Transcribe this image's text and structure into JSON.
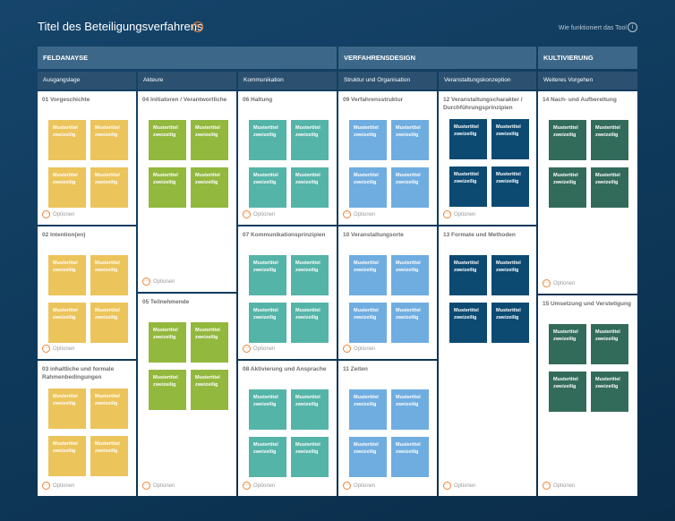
{
  "header": {
    "title": "Titel des Beteiligungsverfahrens",
    "help_link": "Wie funktioniert das Tool",
    "edit_icon": "pencil-icon",
    "info_icon": "info-icon"
  },
  "colors": {
    "yellow": "#ecc45c",
    "green": "#93b83e",
    "teal": "#55b4a8",
    "blue": "#6fade0",
    "navy": "#0c4a72",
    "darkgreen": "#336b5a",
    "accent": "#e8853b"
  },
  "sections": [
    {
      "label": "FELDANAYSE"
    },
    {
      "label": "VERFAHRENSDESIGN"
    },
    {
      "label": "KULTIVIERUNG"
    }
  ],
  "columns": [
    {
      "label": "Ausgangslage"
    },
    {
      "label": "Akteure"
    },
    {
      "label": "Kommunikation"
    },
    {
      "label": "Struktur und Organisation"
    },
    {
      "label": "Veranstaltungskonzeption"
    },
    {
      "label": "Weiteres Vorgehen"
    }
  ],
  "note": {
    "line1": "Mustertitel",
    "line2": "zweizeilig"
  },
  "options_label": "Optionen",
  "panels": [
    {
      "title": "01 Vorgeschichte"
    },
    {
      "title": "02 Intention(en)"
    },
    {
      "title": "03 inhaltliche und formale Rahmenbedingungen"
    },
    {
      "title": "04 Initiatoren / Verantwortliche"
    },
    {
      "title": "05 Teilnehmende"
    },
    {
      "title": "06 Haltung"
    },
    {
      "title": "07 Kommunikationsprinzipien"
    },
    {
      "title": "08 Aktivierung und Ansprache"
    },
    {
      "title": "09 Verfahrensstruktur"
    },
    {
      "title": "10 Veranstaltungsorte"
    },
    {
      "title": "11 Zeiten"
    },
    {
      "title": "12 Veranstaltungscharakter / Durchführungsprinzipien"
    },
    {
      "title": "13 Formate und Methoden"
    },
    {
      "title": "14 Nach- und Aufbereitung"
    },
    {
      "title": "15 Umsetzung und Verstetigung"
    }
  ]
}
